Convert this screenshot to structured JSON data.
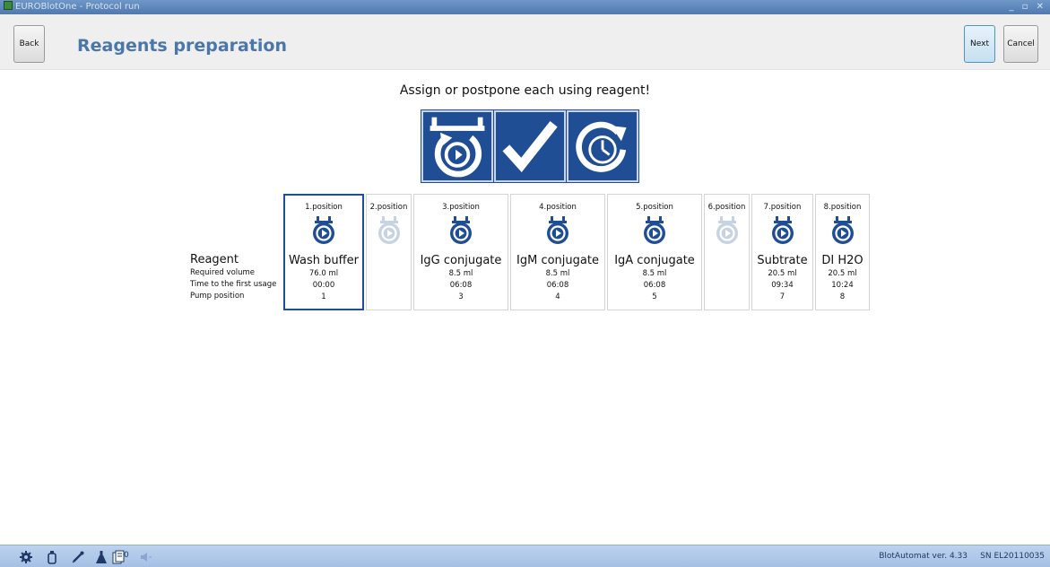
{
  "window": {
    "title": "EUROBlotOne - Protocol run",
    "controls": "_ ▫ ✕"
  },
  "header": {
    "title": "Reagents preparation",
    "back_label": "Back",
    "next_label": "Next",
    "cancel_label": "Cancel"
  },
  "instruction": "Assign or postpone each using reagent!",
  "actions": [
    {
      "name": "assign",
      "icon": "assign-reagent-icon"
    },
    {
      "name": "confirm",
      "icon": "checkmark-icon"
    },
    {
      "name": "postpone",
      "icon": "clock-postpone-icon"
    }
  ],
  "row_labels": {
    "reagent": "Reagent",
    "required_volume": "Required volume",
    "time_first_usage": "Time to the first usage",
    "pump_position": "Pump position"
  },
  "positions": [
    {
      "label": "1.position",
      "reagent": "Wash buffer",
      "volume": "76.0 ml",
      "time": "00:00",
      "pump": "1",
      "active": true,
      "selected": true
    },
    {
      "label": "2.position",
      "reagent": "",
      "volume": "",
      "time": "",
      "pump": "",
      "active": false,
      "selected": false
    },
    {
      "label": "3.position",
      "reagent": "IgG conjugate",
      "volume": "8.5 ml",
      "time": "06:08",
      "pump": "3",
      "active": true,
      "selected": false
    },
    {
      "label": "4.position",
      "reagent": "IgM conjugate",
      "volume": "8.5 ml",
      "time": "06:08",
      "pump": "4",
      "active": true,
      "selected": false
    },
    {
      "label": "5.position",
      "reagent": "IgA conjugate",
      "volume": "8.5 ml",
      "time": "06:08",
      "pump": "5",
      "active": true,
      "selected": false
    },
    {
      "label": "6.position",
      "reagent": "",
      "volume": "",
      "time": "",
      "pump": "",
      "active": false,
      "selected": false
    },
    {
      "label": "7.position",
      "reagent": "Subtrate",
      "volume": "20.5 ml",
      "time": "09:34",
      "pump": "7",
      "active": true,
      "selected": false
    },
    {
      "label": "8.position",
      "reagent": "DI H2O",
      "volume": "20.5 ml",
      "time": "10:24",
      "pump": "8",
      "active": true,
      "selected": false
    }
  ],
  "statusbar": {
    "icons": [
      "gear-icon",
      "bottle-icon",
      "pipette-icon",
      "flask-icon",
      "strips-icon",
      "speaker-icon"
    ],
    "strip_count": "0",
    "version": "BlotAutomat ver. 4.33",
    "serial": "SN EL20110035"
  },
  "colors": {
    "accent": "#1f4e94",
    "title": "#4a76aa",
    "disabled": "#c7d3e3"
  }
}
